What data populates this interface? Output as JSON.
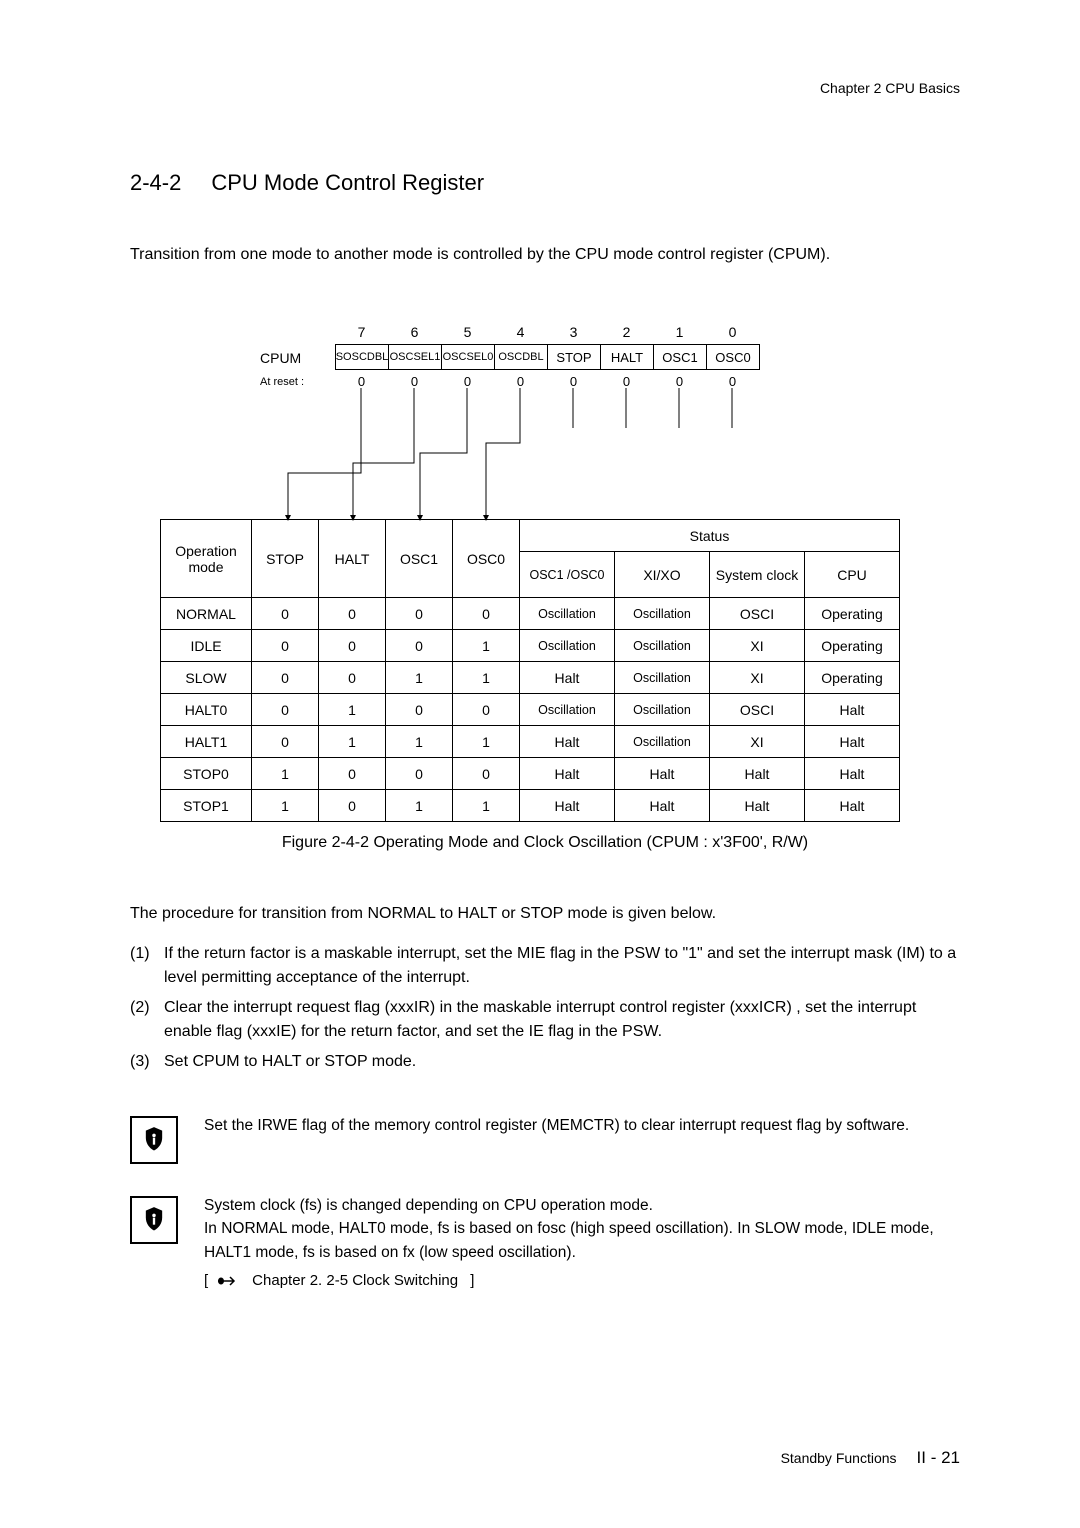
{
  "chapterHeader": "Chapter 2   CPU Basics",
  "section": {
    "num": "2-4-2",
    "title": "CPU Mode Control Register"
  },
  "intro": "Transition from one mode to another mode is controlled by the CPU mode control register (CPUM).",
  "register": {
    "label": "CPUM",
    "bits": [
      "7",
      "6",
      "5",
      "4",
      "3",
      "2",
      "1",
      "0"
    ],
    "fields": [
      "SOSCDBL",
      "OSCSEL1",
      "OSCSEL0",
      "OSCDBL",
      "STOP",
      "HALT",
      "OSC1",
      "OSC0"
    ],
    "resetLabel": "At reset :",
    "resetValues": [
      "0",
      "0",
      "0",
      "0",
      "0",
      "0",
      "0",
      "0"
    ]
  },
  "table": {
    "statusHeader": "Status",
    "headers": [
      "Operation mode",
      "STOP",
      "HALT",
      "OSC1",
      "OSC0",
      "OSC1 /OSC0",
      "XI/XO",
      "System clock",
      "CPU"
    ],
    "rows": [
      [
        "NORMAL",
        "0",
        "0",
        "0",
        "0",
        "Oscillation",
        "Oscillation",
        "OSCI",
        "Operating"
      ],
      [
        "IDLE",
        "0",
        "0",
        "0",
        "1",
        "Oscillation",
        "Oscillation",
        "XI",
        "Operating"
      ],
      [
        "SLOW",
        "0",
        "0",
        "1",
        "1",
        "Halt",
        "Oscillation",
        "XI",
        "Operating"
      ],
      [
        "HALT0",
        "0",
        "1",
        "0",
        "0",
        "Oscillation",
        "Oscillation",
        "OSCI",
        "Halt"
      ],
      [
        "HALT1",
        "0",
        "1",
        "1",
        "1",
        "Halt",
        "Oscillation",
        "XI",
        "Halt"
      ],
      [
        "STOP0",
        "1",
        "0",
        "0",
        "0",
        "Halt",
        "Halt",
        "Halt",
        "Halt"
      ],
      [
        "STOP1",
        "1",
        "0",
        "1",
        "1",
        "Halt",
        "Halt",
        "Halt",
        "Halt"
      ]
    ]
  },
  "figureCaption": "Figure 2-4-2    Operating Mode and Clock Oscillation (CPUM : x'3F00', R/W)",
  "procedureIntro": "The procedure for transition from NORMAL to HALT or STOP mode is given below.",
  "list": [
    {
      "n": "(1)",
      "t": "If the return factor is a maskable interrupt, set the MIE flag in the PSW to \"1\" and set the interrupt mask (IM) to a level permitting acceptance of the interrupt."
    },
    {
      "n": "(2)",
      "t": "Clear the interrupt request flag (xxxIR) in the maskable interrupt control register (xxxICR) , set the interrupt enable flag (xxxIE) for the return factor, and set the IE flag in the PSW."
    },
    {
      "n": "(3)",
      "t": "Set CPUM to HALT or STOP mode."
    }
  ],
  "note1": "Set the IRWE flag of the memory control register (MEMCTR) to clear interrupt request  flag by software.",
  "note2": {
    "line1": "System clock (fs) is changed depending on CPU operation mode.",
    "line2": "In NORMAL mode, HALT0 mode, fs is based on fosc (high speed oscillation). In SLOW mode, IDLE mode, HALT1 mode, fs is based on fx (low speed oscillation).",
    "ref": "Chapter 2. 2-5  Clock Switching"
  },
  "footer": {
    "label": "Standby Functions",
    "page": "II - 21"
  }
}
